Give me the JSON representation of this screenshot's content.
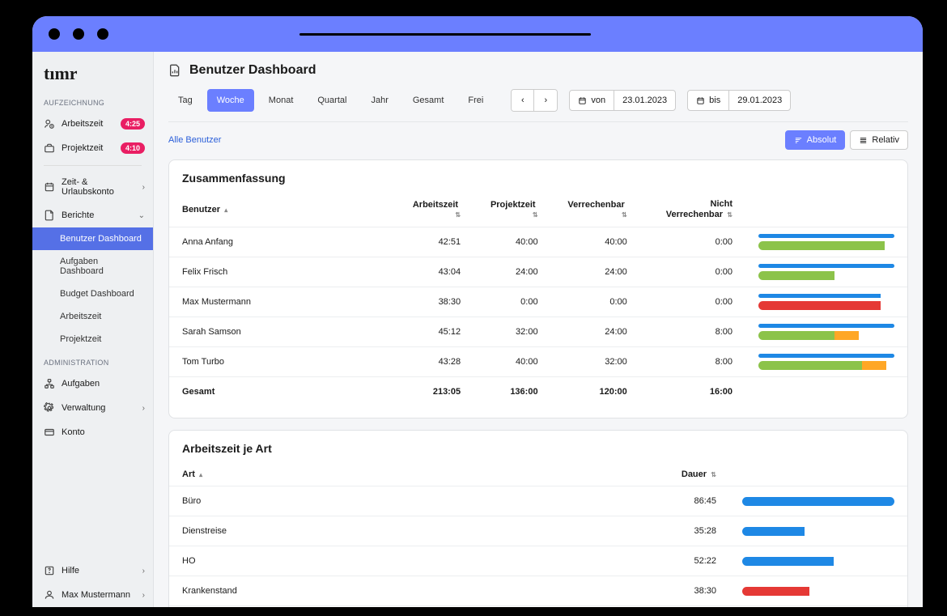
{
  "logo": "tımr",
  "sidebar": {
    "section_recording": "AUFZEICHNUNG",
    "worktime": {
      "label": "Arbeitszeit",
      "badge": "4:25"
    },
    "projecttime": {
      "label": "Projektzeit",
      "badge": "4:10"
    },
    "vacation": {
      "label": "Zeit- & Urlaubskonto"
    },
    "reports": {
      "label": "Berichte"
    },
    "sub_user_dashboard": "Benutzer Dashboard",
    "sub_task_dashboard": "Aufgaben Dashboard",
    "sub_budget_dashboard": "Budget Dashboard",
    "sub_worktime": "Arbeitszeit",
    "sub_projecttime": "Projektzeit",
    "section_admin": "ADMINISTRATION",
    "tasks": "Aufgaben",
    "management": "Verwaltung",
    "account": "Konto",
    "help": "Hilfe",
    "username": "Max Mustermann"
  },
  "header": {
    "title": "Benutzer Dashboard"
  },
  "periods": {
    "day": "Tag",
    "week": "Woche",
    "month": "Monat",
    "quarter": "Quartal",
    "year": "Jahr",
    "total": "Gesamt",
    "free": "Frei"
  },
  "dates": {
    "from_label": "von",
    "from_value": "23.01.2023",
    "to_label": "bis",
    "to_value": "29.01.2023"
  },
  "filters": {
    "all_users": "Alle Benutzer",
    "absolute": "Absolut",
    "relative": "Relativ"
  },
  "summary": {
    "title": "Zusammenfassung",
    "col_user": "Benutzer",
    "col_worktime": "Arbeitszeit",
    "col_projecttime": "Projektzeit",
    "col_billable": "Verrechenbar",
    "col_nonbillable": "Nicht Verrechenbar",
    "rows": [
      {
        "name": "Anna Anfang",
        "worktime": "42:51",
        "projecttime": "40:00",
        "billable": "40:00",
        "nonbillable": "0:00"
      },
      {
        "name": "Felix Frisch",
        "worktime": "43:04",
        "projecttime": "24:00",
        "billable": "24:00",
        "nonbillable": "0:00"
      },
      {
        "name": "Max Mustermann",
        "worktime": "38:30",
        "projecttime": "0:00",
        "billable": "0:00",
        "nonbillable": "0:00"
      },
      {
        "name": "Sarah Samson",
        "worktime": "45:12",
        "projecttime": "32:00",
        "billable": "24:00",
        "nonbillable": "8:00"
      },
      {
        "name": "Tom Turbo",
        "worktime": "43:28",
        "projecttime": "40:00",
        "billable": "32:00",
        "nonbillable": "8:00"
      }
    ],
    "total_label": "Gesamt",
    "total": {
      "worktime": "213:05",
      "projecttime": "136:00",
      "billable": "120:00",
      "nonbillable": "16:00"
    }
  },
  "worktime_by_type": {
    "title": "Arbeitszeit je Art",
    "col_type": "Art",
    "col_duration": "Dauer",
    "rows": [
      {
        "name": "Büro",
        "duration": "86:45"
      },
      {
        "name": "Dienstreise",
        "duration": "35:28"
      },
      {
        "name": "HO",
        "duration": "52:22"
      },
      {
        "name": "Krankenstand",
        "duration": "38:30"
      }
    ]
  },
  "chart_data": [
    {
      "type": "bar",
      "title": "Zusammenfassung",
      "categories": [
        "Anna Anfang",
        "Felix Frisch",
        "Max Mustermann",
        "Sarah Samson",
        "Tom Turbo",
        "Gesamt"
      ],
      "series": [
        {
          "name": "Arbeitszeit",
          "values": [
            42.85,
            43.07,
            38.5,
            45.2,
            43.47,
            213.08
          ]
        },
        {
          "name": "Projektzeit",
          "values": [
            40,
            24,
            0,
            32,
            40,
            136
          ]
        },
        {
          "name": "Verrechenbar",
          "values": [
            40,
            24,
            0,
            24,
            32,
            120
          ]
        },
        {
          "name": "Nicht Verrechenbar",
          "values": [
            0,
            0,
            0,
            8,
            8,
            16
          ]
        }
      ],
      "bar_visuals": [
        {
          "top_blue_pct": 100,
          "bot_segments": [
            {
              "color": "green",
              "pct": 93
            }
          ]
        },
        {
          "top_blue_pct": 100,
          "bot_segments": [
            {
              "color": "green",
              "pct": 56
            }
          ]
        },
        {
          "top_blue_pct": 90,
          "bot_segments": [
            {
              "color": "red",
              "pct": 90
            }
          ]
        },
        {
          "top_blue_pct": 100,
          "bot_segments": [
            {
              "color": "green",
              "pct": 56
            },
            {
              "color": "orange",
              "pct": 18
            }
          ]
        },
        {
          "top_blue_pct": 100,
          "bot_segments": [
            {
              "color": "green",
              "pct": 76
            },
            {
              "color": "orange",
              "pct": 18
            }
          ]
        }
      ]
    },
    {
      "type": "bar",
      "title": "Arbeitszeit je Art",
      "categories": [
        "Büro",
        "Dienstreise",
        "HO",
        "Krankenstand"
      ],
      "values": [
        86.75,
        35.47,
        52.37,
        38.5
      ],
      "bar_visuals": [
        {
          "color": "blue",
          "pct": 100
        },
        {
          "color": "blue",
          "pct": 41
        },
        {
          "color": "blue",
          "pct": 60
        },
        {
          "color": "red",
          "pct": 44
        }
      ]
    }
  ]
}
